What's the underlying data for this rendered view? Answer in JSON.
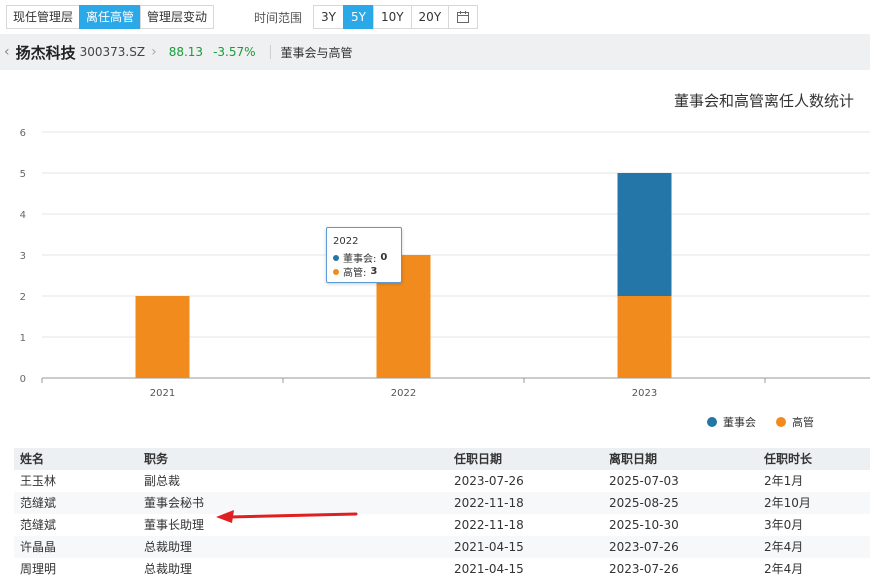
{
  "tabs": [
    {
      "label": "现任管理层",
      "active": false
    },
    {
      "label": "离任高管",
      "active": true
    },
    {
      "label": "管理层变动",
      "active": false
    }
  ],
  "time_range": {
    "label": "时间范围",
    "options": [
      {
        "label": "3Y",
        "active": false
      },
      {
        "label": "5Y",
        "active": true
      },
      {
        "label": "10Y",
        "active": false
      },
      {
        "label": "20Y",
        "active": false
      }
    ],
    "calendar_icon": "calendar-icon"
  },
  "stock": {
    "name": "扬杰科技",
    "code": "300373.SZ",
    "price": "88.13",
    "change": "-3.57%",
    "section": "董事会与高管",
    "change_color": "#1a9c3a"
  },
  "tooltip": {
    "title": "2022",
    "rows": [
      {
        "label": "董事会:",
        "value": "0"
      },
      {
        "label": "高管:",
        "value": "3"
      }
    ]
  },
  "chart_data": {
    "type": "bar",
    "stacked": true,
    "title": "董事会和高管离任人数统计",
    "categories": [
      "2021",
      "2022",
      "2023"
    ],
    "series": [
      {
        "name": "高管",
        "values": [
          2,
          3,
          2
        ],
        "color": "#f28b1e"
      },
      {
        "name": "董事会",
        "values": [
          0,
          0,
          3
        ],
        "color": "#2476a8"
      }
    ],
    "ylim": [
      0,
      6
    ],
    "yticks": [
      "0",
      "1",
      "2",
      "3",
      "4",
      "5",
      "6"
    ],
    "grid": true,
    "legend_position": "bottom-right"
  },
  "table": {
    "headers": [
      "姓名",
      "职务",
      "任职日期",
      "离职日期",
      "任职时长"
    ],
    "rows": [
      [
        "王玉林",
        "副总裁",
        "2023-07-26",
        "2025-07-03",
        "2年1月"
      ],
      [
        "范缝斌",
        "董事会秘书",
        "2022-11-18",
        "2025-08-25",
        "2年10月"
      ],
      [
        "范缝斌",
        "董事长助理",
        "2022-11-18",
        "2025-10-30",
        "3年0月"
      ],
      [
        "许晶晶",
        "总裁助理",
        "2021-04-15",
        "2023-07-26",
        "2年4月"
      ],
      [
        "周理明",
        "总裁助理",
        "2021-04-15",
        "2023-07-26",
        "2年4月"
      ]
    ]
  },
  "annotation": {
    "arrow_color": "#e02020"
  }
}
